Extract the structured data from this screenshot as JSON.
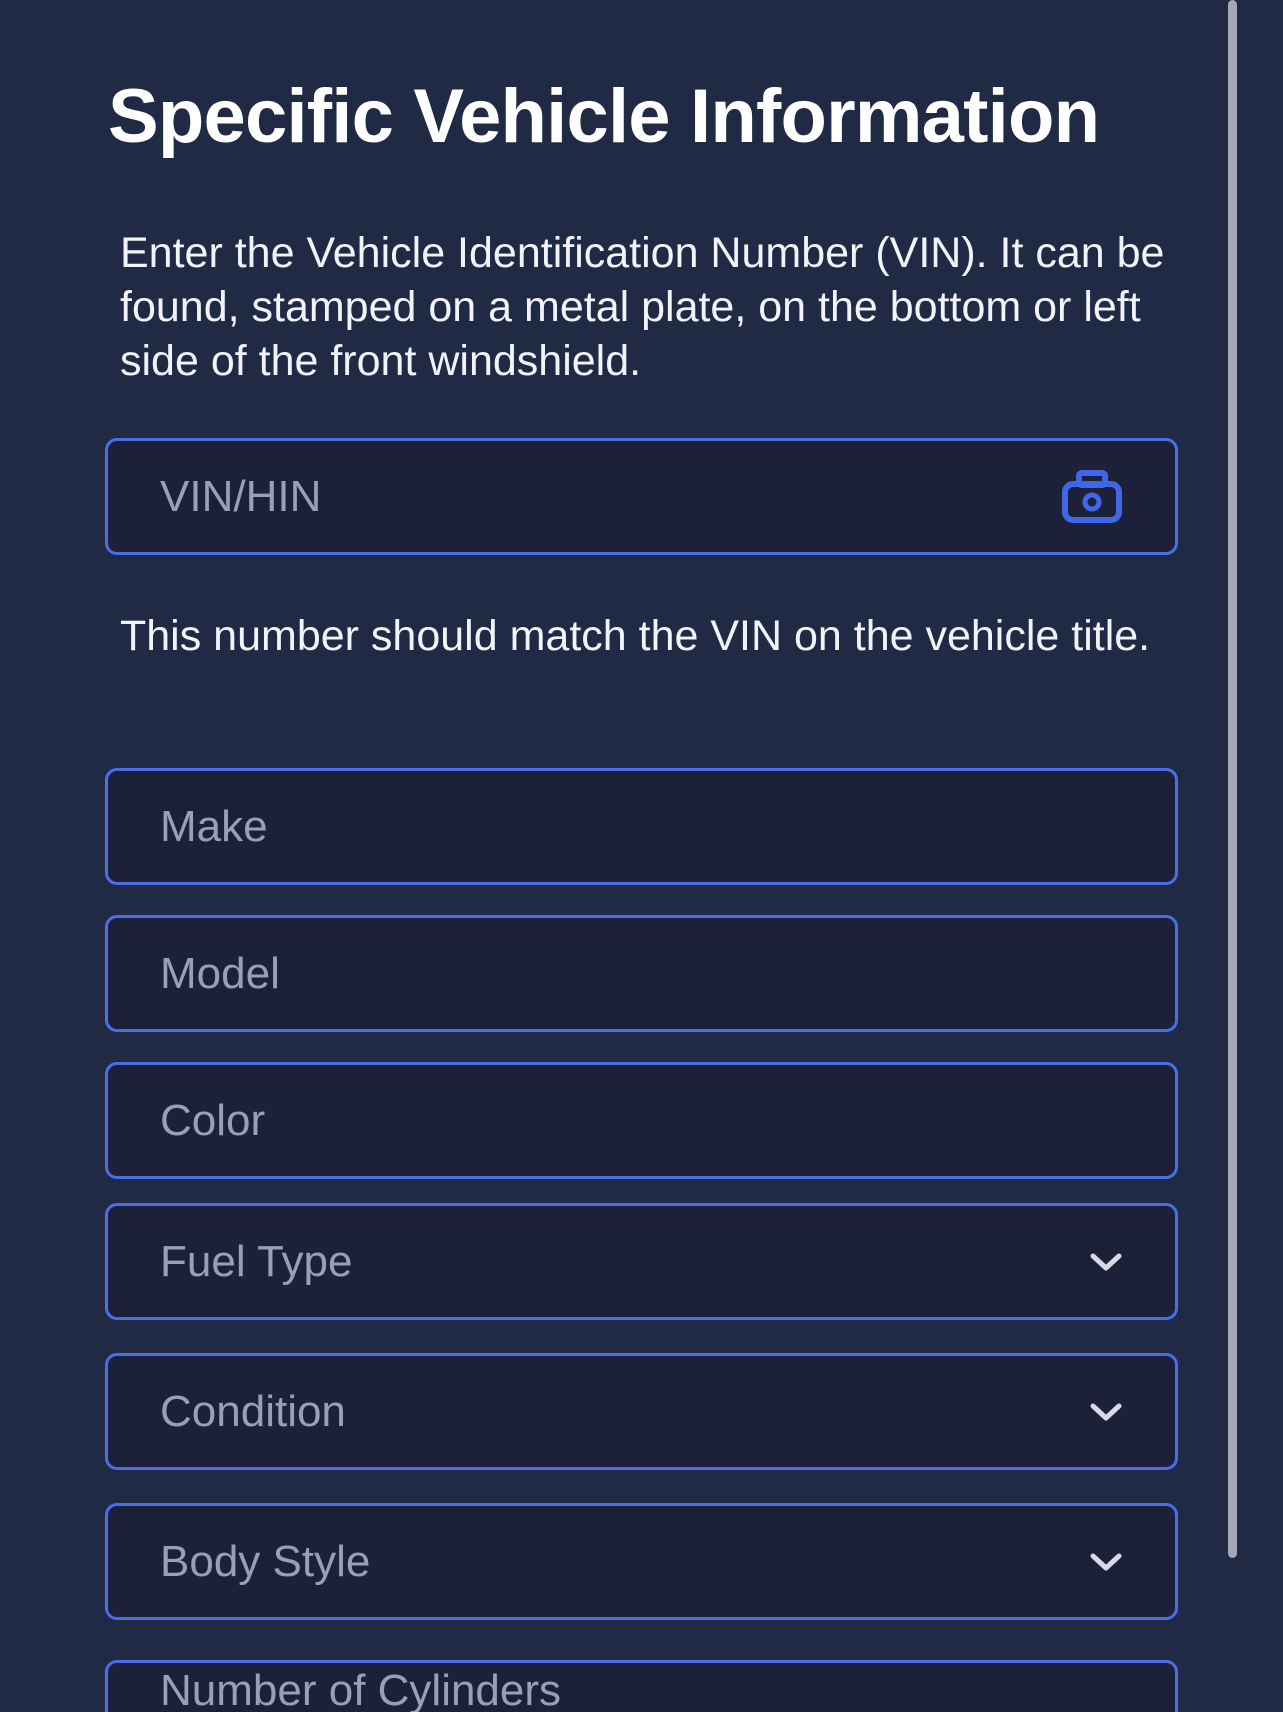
{
  "page": {
    "title": "Specific Vehicle Information",
    "vin_instructions": "Enter the Vehicle Identification Number (VIN). It can be found, stamped on a metal plate, on the bottom or left side of the front windshield.",
    "vin_note": "This number should match the VIN on the vehicle title."
  },
  "form": {
    "vin": {
      "placeholder": "VIN/HIN",
      "icon": "camera-icon"
    },
    "make": {
      "placeholder": "Make"
    },
    "model": {
      "placeholder": "Model"
    },
    "color": {
      "placeholder": "Color"
    },
    "fuel_type": {
      "placeholder": "Fuel Type",
      "icon": "chevron-down-icon"
    },
    "condition": {
      "placeholder": "Condition",
      "icon": "chevron-down-icon"
    },
    "body_style": {
      "placeholder": "Body Style",
      "icon": "chevron-down-icon"
    },
    "cylinders": {
      "placeholder": "Number of Cylinders"
    }
  },
  "colors": {
    "background": "#212a45",
    "field_background": "#1c2039",
    "field_border": "#4b6ee7",
    "placeholder_text": "#98a0b8",
    "accent": "#3f67e8",
    "chevron": "#d7dbe5"
  }
}
